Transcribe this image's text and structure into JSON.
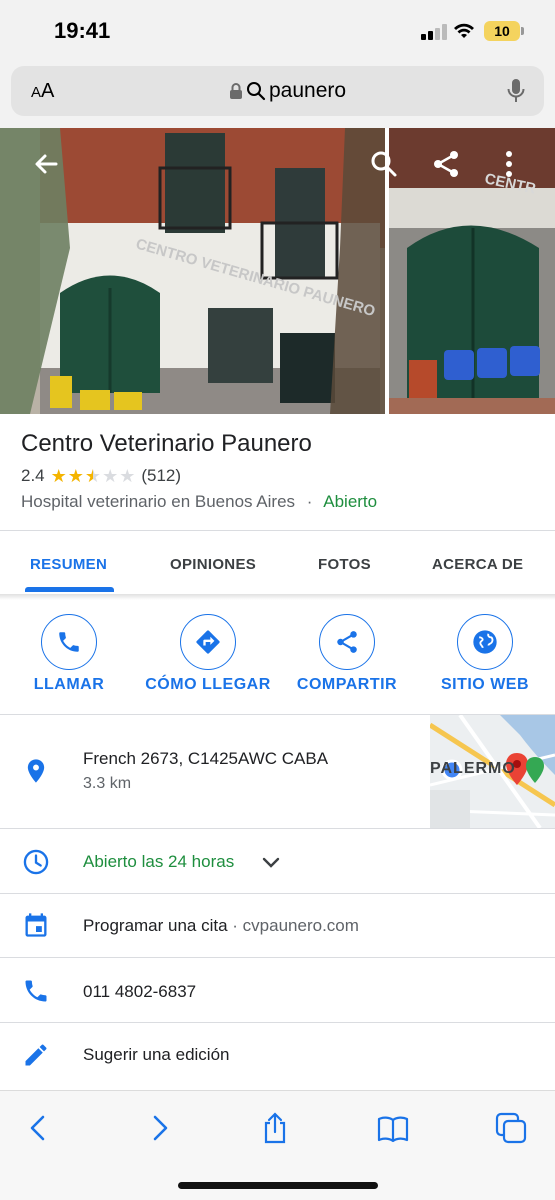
{
  "status_bar": {
    "time": "19:41",
    "battery": "10"
  },
  "url_bar": {
    "text_size": "AA",
    "query": "paunero"
  },
  "place": {
    "name": "Centro Veterinario Paunero",
    "rating": "2.4",
    "rating_value": 2.4,
    "review_count": "(512)",
    "category": "Hospital veterinario en Buenos Aires",
    "separator": "·",
    "status": "Abierto"
  },
  "photo_signs": {
    "main": "CENTRO VETERINARIO PAUNERO",
    "side": "CENTR"
  },
  "tabs": [
    {
      "label": "RESUMEN",
      "active": true
    },
    {
      "label": "OPINIONES",
      "active": false
    },
    {
      "label": "FOTOS",
      "active": false
    },
    {
      "label": "ACERCA DE",
      "active": false
    }
  ],
  "actions": [
    {
      "label": "LLAMAR",
      "icon": "phone-icon"
    },
    {
      "label": "CÓMO LLEGAR",
      "icon": "directions-icon"
    },
    {
      "label": "COMPARTIR",
      "icon": "share-icon"
    },
    {
      "label": "SITIO WEB",
      "icon": "globe-icon"
    }
  ],
  "info": {
    "address": "French 2673, C1425AWC CABA",
    "distance": "3.3 km",
    "map_label": "PALERMO",
    "hours": "Abierto las 24 horas",
    "appointment": "Programar una cita",
    "appointment_site": " · cvpaunero.com",
    "phone": "011 4802-6837",
    "suggest_edit": "Sugerir una edición"
  },
  "colors": {
    "accent": "#1a73e8",
    "open": "#1e8e3e",
    "star": "#f4b400"
  }
}
